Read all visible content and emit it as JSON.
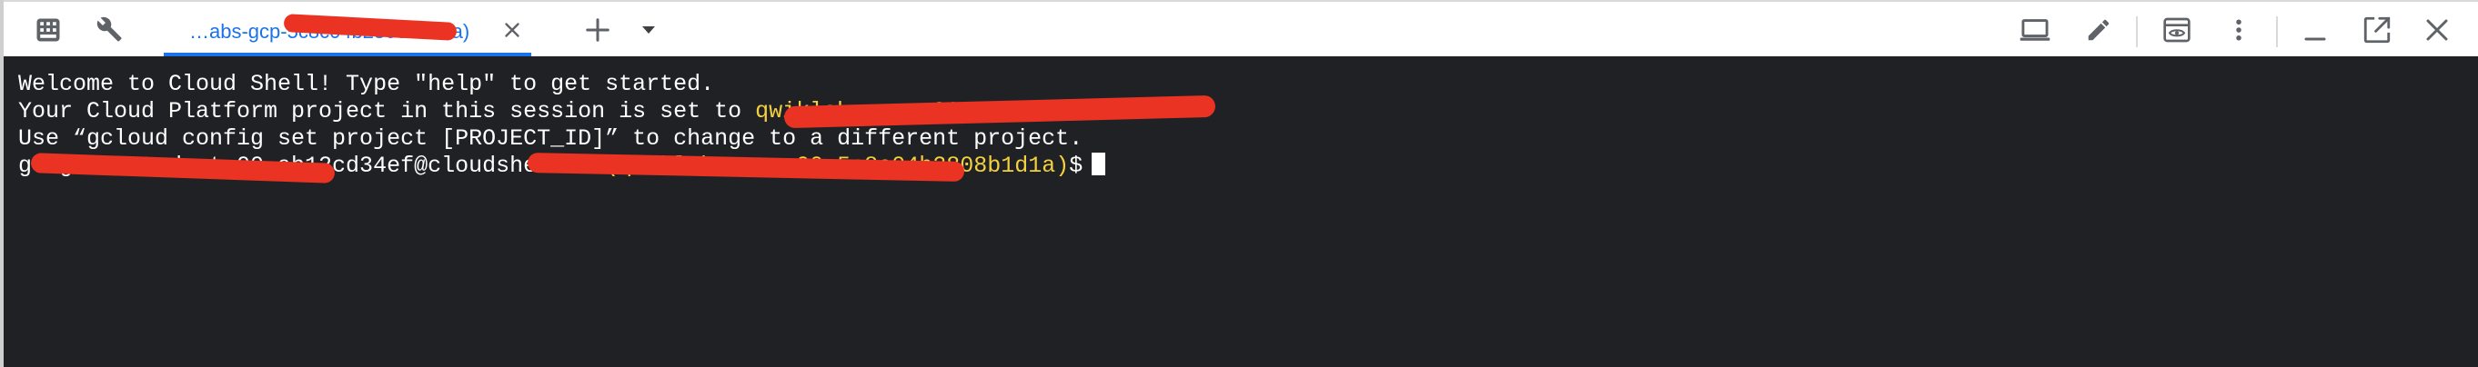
{
  "toolbar": {
    "tab_label": "…abs-gcp-5c8c04b2808b1d1a)",
    "icons": {
      "left": [
        "keyboard-icon",
        "wrench-icon",
        "plus-icon",
        "chevron-down-icon"
      ],
      "right": [
        "laptop-icon",
        "pencil-icon",
        "web-preview-icon",
        "more-vert-icon",
        "minimize-icon",
        "open-in-new-icon",
        "close-icon"
      ]
    }
  },
  "terminal": {
    "line1": "Welcome to Cloud Shell! Type \"help\" to get started.",
    "line2_prefix": "Your Cloud Platform project in this session is set to ",
    "line2_project": "qwiklabs-gcp-00-5c8c04b2808b1d1a",
    "line2_suffix": ".",
    "line3": "Use “gcloud config set project [PROJECT_ID]” to change to a different project.",
    "prompt_user": "google3_student_00_ab12cd34ef",
    "prompt_host": "@cloudshell:",
    "prompt_path": "~",
    "prompt_open": " (",
    "prompt_project": "qwiklabs-gcp-00-5c8c04b2808b1d1a",
    "prompt_close": ")",
    "prompt_symbol": "$"
  },
  "colors": {
    "terminal_bg": "#202124",
    "terminal_fg": "#ffffff",
    "project_yellow": "#f4d03f",
    "path_blue": "#8ab4f8",
    "tab_accent": "#1a73e8",
    "redaction_red": "#ea3323"
  }
}
